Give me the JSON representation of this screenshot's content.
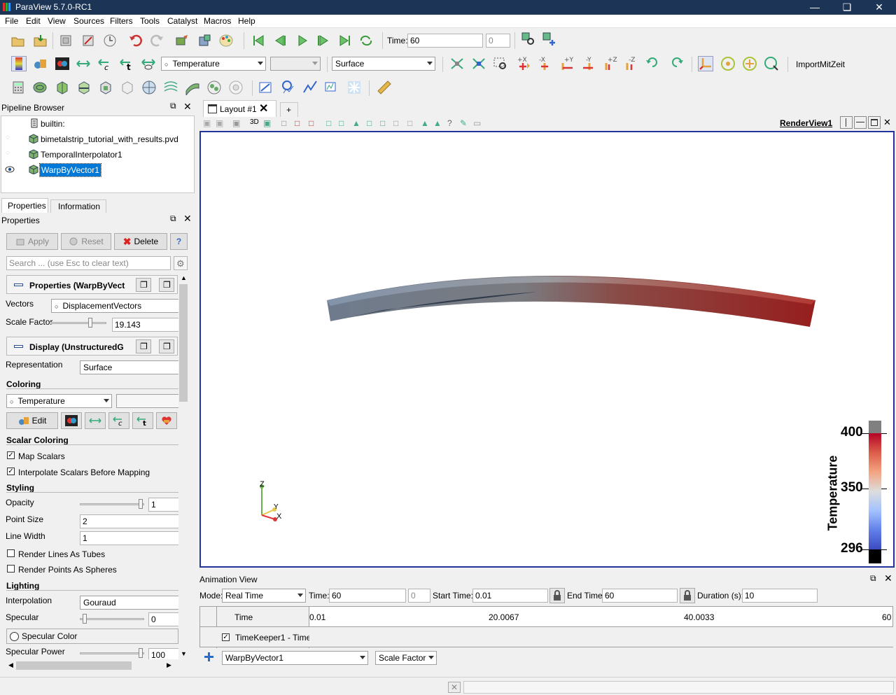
{
  "window": {
    "title": "ParaView 5.7.0-RC1"
  },
  "menu": [
    "File",
    "Edit",
    "View",
    "Sources",
    "Filters",
    "Tools",
    "Catalyst",
    "Macros",
    "Help"
  ],
  "vcr": {
    "time_label": "Time:",
    "time_value": "60",
    "time_index": "0"
  },
  "toolbar2": {
    "color_array": "Temperature",
    "component": "",
    "representation": "Surface",
    "import_label": "ImportMitZeit",
    "rot_plus": "+90",
    "rot_minus": "-90"
  },
  "pipeline": {
    "title": "Pipeline Browser",
    "items": [
      {
        "label": "builtin:"
      },
      {
        "label": "bimetalstrip_tutorial_with_results.pvd"
      },
      {
        "label": "TemporalInterpolator1"
      },
      {
        "label": "WarpByVector1"
      }
    ]
  },
  "tabs": {
    "properties": "Properties",
    "information": "Information"
  },
  "properties": {
    "title": "Properties",
    "apply": "Apply",
    "reset": "Reset",
    "delete": "Delete",
    "help": "?",
    "search_placeholder": "Search ... (use Esc to clear text)",
    "group1": "Properties (WarpByVect",
    "vectors_label": "Vectors",
    "vectors_value": "DisplacementVectors",
    "scale_label": "Scale Factor",
    "scale_value": "19.143",
    "group2": "Display (UnstructuredG",
    "repr_label": "Representation",
    "repr_value": "Surface",
    "coloring": "Coloring",
    "color_array": "Temperature",
    "edit": "Edit",
    "scalar_coloring": "Scalar Coloring",
    "map_scalars": "Map Scalars",
    "interp_scalars": "Interpolate Scalars Before Mapping",
    "styling": "Styling",
    "opacity_label": "Opacity",
    "opacity_value": "1",
    "point_size_label": "Point Size",
    "point_size_value": "2",
    "line_width_label": "Line Width",
    "line_width_value": "1",
    "render_lines": "Render Lines As Tubes",
    "render_points": "Render Points As Spheres",
    "lighting": "Lighting",
    "interp_label": "Interpolation",
    "interp_value": "Gouraud",
    "specular_label": "Specular",
    "specular_value": "0",
    "specular_color": "Specular Color",
    "specular_power_label": "Specular Power",
    "specular_power_value": "100"
  },
  "layout": {
    "tab": "Layout #1",
    "add": "+",
    "view_name": "RenderView1",
    "mode_3d": "3D"
  },
  "colorbar": {
    "title": "Temperature",
    "max": "400",
    "mid": "350",
    "min": "296"
  },
  "axes": {
    "z": "Z",
    "y": "Y",
    "x": "X"
  },
  "animation": {
    "title": "Animation View",
    "mode_label": "Mode:",
    "mode_value": "Real Time",
    "time_label": "Time:",
    "time_value": "60",
    "time_index": "0",
    "start_label": "Start Time:",
    "start_value": "0.01",
    "end_label": "End Time:",
    "end_value": "60",
    "duration_label": "Duration (s):",
    "duration_value": "10",
    "track_time": "Time",
    "ticks": [
      "0.01",
      "20.0067",
      "40.0033",
      "60"
    ],
    "timekeeper": "TimeKeeper1 - Time",
    "source_select": "WarpByVector1",
    "prop_select": "Scale Factor"
  }
}
